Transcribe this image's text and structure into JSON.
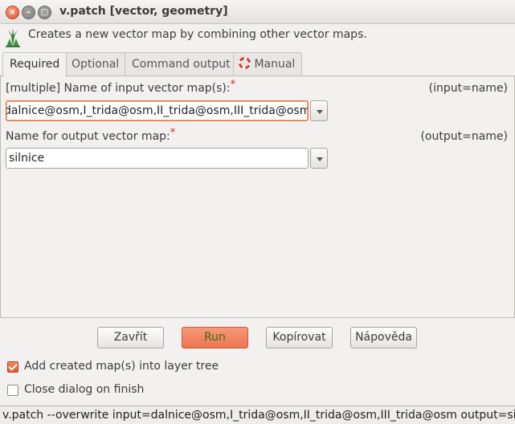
{
  "window": {
    "title": "v.patch [vector, geometry]",
    "controls": [
      "close-icon",
      "minimize-icon",
      "maximize-icon"
    ]
  },
  "header": {
    "icon": "grass-logo-icon",
    "description": "Creates a new vector map by combining other vector maps."
  },
  "tabs": [
    {
      "label": "Required",
      "active": true
    },
    {
      "label": "Optional",
      "active": false
    },
    {
      "label": "Command output",
      "active": false
    },
    {
      "label": "Manual",
      "active": false,
      "icon": "lifebuoy-icon"
    }
  ],
  "fields": {
    "input": {
      "label": "[multiple] Name of input vector map(s):",
      "required_mark": "*",
      "param": "(input=name)",
      "value": "dalnice@osm,I_trida@osm,II_trida@osm,III_trida@osm"
    },
    "output": {
      "label": "Name for output vector map:",
      "required_mark": "*",
      "param": "(output=name)",
      "value": "silnice"
    }
  },
  "buttons": {
    "close": "Zavřít",
    "run": "Run",
    "copy": "Kopírovat",
    "help": "Nápověda"
  },
  "checkboxes": {
    "add_to_tree": {
      "label": "Add created map(s) into layer tree",
      "checked": true
    },
    "close_on_finish": {
      "label": "Close dialog on finish",
      "checked": false
    }
  },
  "command_line": "v.patch --overwrite input=dalnice@osm,I_trida@osm,II_trida@osm,III_trida@osm output=silnice",
  "colors": {
    "accent": "#e2562d",
    "run_button": "#ee7450",
    "required_mark": "#d2281a"
  }
}
